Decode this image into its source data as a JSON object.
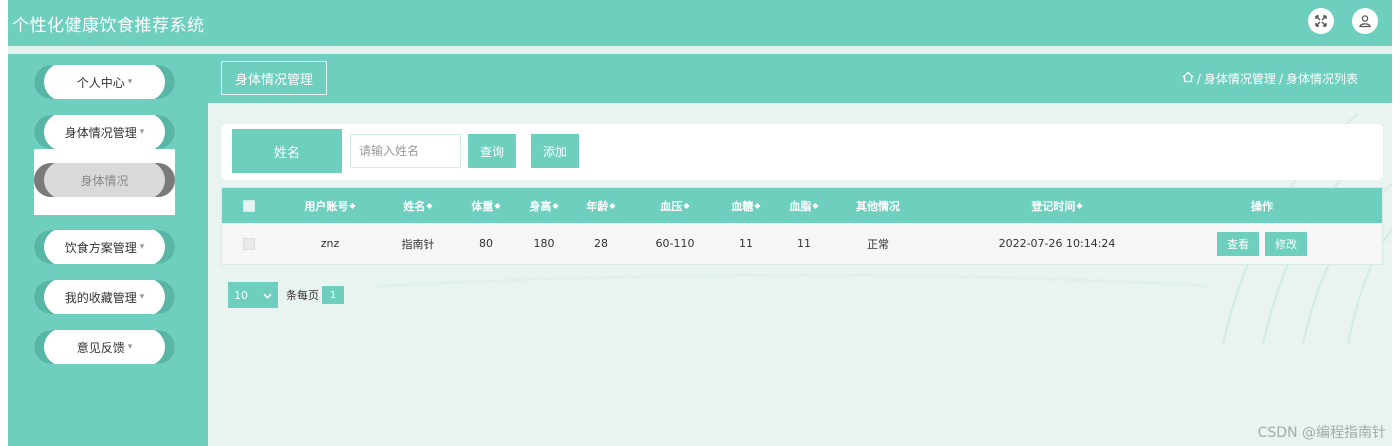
{
  "app": {
    "title": "个性化健康饮食推荐系统"
  },
  "topbar": {
    "icons": [
      "fullscreen-icon",
      "user-icon"
    ]
  },
  "sidebar": {
    "items": [
      {
        "label": "个人中心"
      },
      {
        "label": "身体情况管理"
      },
      {
        "label": "饮食方案管理"
      },
      {
        "label": "我的收藏管理"
      },
      {
        "label": "意见反馈"
      }
    ],
    "submenu": {
      "label": "身体情况"
    }
  },
  "header": {
    "tab_label": "身体情况管理",
    "breadcrumb": {
      "separator": "/",
      "items": [
        "身体情况管理",
        "身体情况列表"
      ]
    }
  },
  "search": {
    "label": "姓名",
    "placeholder": "请输入姓名",
    "search_button": "查询",
    "add_button": "添加"
  },
  "table": {
    "columns": [
      "用户账号",
      "姓名",
      "体重",
      "身高",
      "年龄",
      "血压",
      "血糖",
      "血脂",
      "其他情况",
      "登记时间",
      "操作"
    ],
    "sort_mark": "◆",
    "rows": [
      {
        "username": "znz",
        "name": "指南针",
        "weight": "80",
        "height": "180",
        "age": "28",
        "blood_pressure": "60-110",
        "blood_sugar": "11",
        "blood_lipid": "11",
        "other": "正常",
        "register_time": "2022-07-26 10:14:24",
        "actions": {
          "view": "查看",
          "edit": "修改"
        }
      }
    ]
  },
  "pagination": {
    "page_size": "10",
    "per_page_label": "条每页",
    "current_page": "1"
  },
  "watermark": "CSDN @编程指南针",
  "colors": {
    "primary": "#6ecfbf",
    "accent_dark": "#57b6a6",
    "main_bg": "#e9f3ef"
  }
}
